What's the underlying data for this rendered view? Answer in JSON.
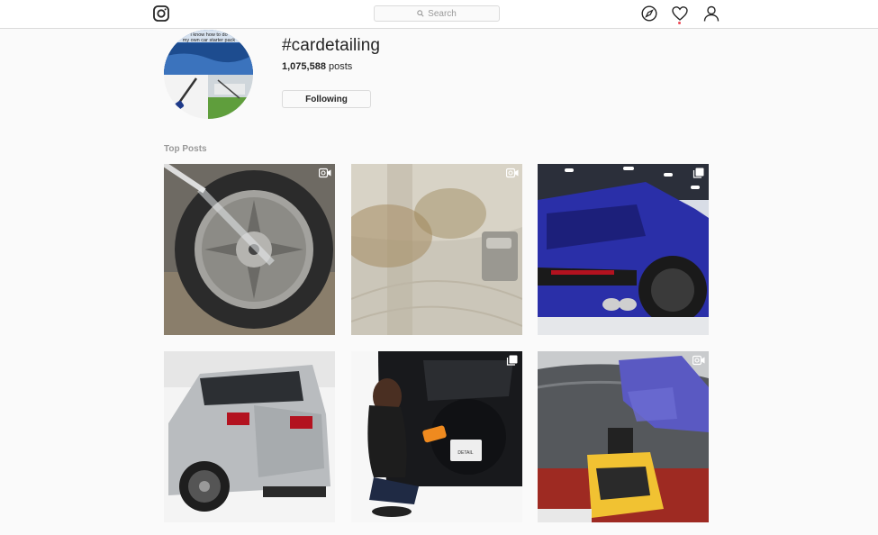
{
  "search": {
    "placeholder": "Search"
  },
  "profile": {
    "hashtag": "#cardetailing",
    "post_count": "1,075,588",
    "post_count_suffix": "posts",
    "follow_label": "Following",
    "avatar_caption": "I know how to do my own car starter pack"
  },
  "section": {
    "top_posts_label": "Top Posts"
  },
  "posts": [
    {
      "name": "post-wheel-pressure-wash",
      "badge": "video-icon"
    },
    {
      "name": "post-seat-cleaning",
      "badge": "video-icon"
    },
    {
      "name": "post-blue-lamborghini",
      "badge": "carousel-icon"
    },
    {
      "name": "post-silver-mercedes",
      "badge": "none"
    },
    {
      "name": "post-woman-detailing",
      "badge": "carousel-icon"
    },
    {
      "name": "post-polishing",
      "badge": "video-icon"
    }
  ],
  "colors": {
    "accent": "#ed4956",
    "border": "#dbdbdb",
    "muted": "#999999"
  }
}
